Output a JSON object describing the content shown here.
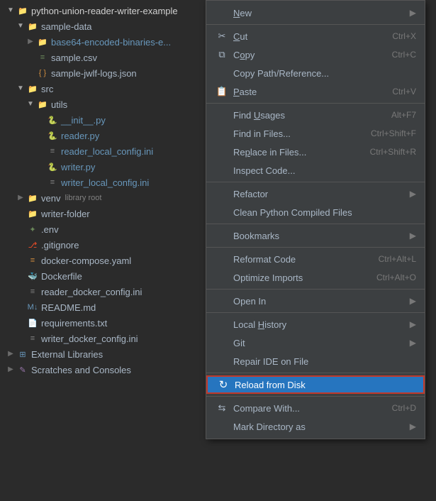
{
  "app": {
    "title": "python-union-reader-writer-example"
  },
  "filetree": {
    "items": [
      {
        "id": "root",
        "label": "python-union-reader-writer-exa...",
        "type": "folder-open",
        "indent": 1,
        "arrow": "▼"
      },
      {
        "id": "sample-data",
        "label": "sample-data",
        "type": "folder-open",
        "indent": 2,
        "arrow": "▼"
      },
      {
        "id": "base64",
        "label": "base64-encoded-binaries-e...",
        "type": "folder",
        "indent": 3,
        "arrow": "▶"
      },
      {
        "id": "sample-csv",
        "label": "sample.csv",
        "type": "csv",
        "indent": 3,
        "arrow": ""
      },
      {
        "id": "sample-json",
        "label": "sample-jwlf-logs.json",
        "type": "json",
        "indent": 3,
        "arrow": ""
      },
      {
        "id": "src",
        "label": "src",
        "type": "folder-open",
        "indent": 2,
        "arrow": "▼"
      },
      {
        "id": "utils",
        "label": "utils",
        "type": "folder-open",
        "indent": 3,
        "arrow": "▼"
      },
      {
        "id": "init",
        "label": "__init__.py",
        "type": "python",
        "indent": 4,
        "arrow": ""
      },
      {
        "id": "reader",
        "label": "reader.py",
        "type": "python",
        "indent": 4,
        "arrow": ""
      },
      {
        "id": "reader-config",
        "label": "reader_local_config.ini",
        "type": "ini",
        "indent": 4,
        "arrow": ""
      },
      {
        "id": "writer",
        "label": "writer.py",
        "type": "python",
        "indent": 4,
        "arrow": ""
      },
      {
        "id": "writer-config",
        "label": "writer_local_config.ini",
        "type": "ini",
        "indent": 4,
        "arrow": ""
      },
      {
        "id": "venv",
        "label": "venv",
        "type": "folder",
        "indent": 2,
        "arrow": "▶",
        "badge": "library root"
      },
      {
        "id": "writer-folder",
        "label": "writer-folder",
        "type": "folder",
        "indent": 2,
        "arrow": ""
      },
      {
        "id": "env",
        "label": ".env",
        "type": "env",
        "indent": 2,
        "arrow": ""
      },
      {
        "id": "gitignore",
        "label": ".gitignore",
        "type": "git",
        "indent": 2,
        "arrow": ""
      },
      {
        "id": "docker-compose",
        "label": "docker-compose.yaml",
        "type": "yaml",
        "indent": 2,
        "arrow": ""
      },
      {
        "id": "dockerfile",
        "label": "Dockerfile",
        "type": "docker",
        "indent": 2,
        "arrow": ""
      },
      {
        "id": "reader-docker",
        "label": "reader_docker_config.ini",
        "type": "ini",
        "indent": 2,
        "arrow": ""
      },
      {
        "id": "readme",
        "label": "README.md",
        "type": "md",
        "indent": 2,
        "arrow": ""
      },
      {
        "id": "requirements",
        "label": "requirements.txt",
        "type": "txt",
        "indent": 2,
        "arrow": ""
      },
      {
        "id": "writer-docker",
        "label": "writer_docker_config.ini",
        "type": "ini",
        "indent": 2,
        "arrow": ""
      },
      {
        "id": "ext-libs",
        "label": "External Libraries",
        "type": "library",
        "indent": 1,
        "arrow": "▶"
      },
      {
        "id": "scratches",
        "label": "Scratches and Consoles",
        "type": "scratch",
        "indent": 1,
        "arrow": "▶"
      }
    ]
  },
  "contextmenu": {
    "items": [
      {
        "id": "new",
        "label": "New",
        "icon": "",
        "shortcut": "",
        "arrow": "▶",
        "separator_after": false,
        "type": "submenu"
      },
      {
        "id": "sep1",
        "type": "separator"
      },
      {
        "id": "cut",
        "label": "Cut",
        "icon": "✂",
        "shortcut": "Ctrl+X",
        "arrow": "",
        "type": "action",
        "underline_char": "C"
      },
      {
        "id": "copy",
        "label": "Copy",
        "icon": "⧉",
        "shortcut": "Ctrl+C",
        "arrow": "",
        "type": "action",
        "underline_char": "o"
      },
      {
        "id": "copy-path",
        "label": "Copy Path/Reference...",
        "icon": "",
        "shortcut": "",
        "arrow": "",
        "type": "action"
      },
      {
        "id": "paste",
        "label": "Paste",
        "icon": "📋",
        "shortcut": "Ctrl+V",
        "arrow": "",
        "type": "action",
        "underline_char": "P"
      },
      {
        "id": "sep2",
        "type": "separator"
      },
      {
        "id": "find-usages",
        "label": "Find Usages",
        "icon": "",
        "shortcut": "Alt+F7",
        "arrow": "",
        "type": "action",
        "underline_char": "U"
      },
      {
        "id": "find-in-files",
        "label": "Find in Files...",
        "icon": "",
        "shortcut": "Ctrl+Shift+F",
        "arrow": "",
        "type": "action"
      },
      {
        "id": "replace-in-files",
        "label": "Replace in Files...",
        "icon": "",
        "shortcut": "Ctrl+Shift+R",
        "arrow": "",
        "type": "action"
      },
      {
        "id": "inspect-code",
        "label": "Inspect Code...",
        "icon": "",
        "shortcut": "",
        "arrow": "",
        "type": "action"
      },
      {
        "id": "sep3",
        "type": "separator"
      },
      {
        "id": "refactor",
        "label": "Refactor",
        "icon": "",
        "shortcut": "",
        "arrow": "▶",
        "type": "submenu"
      },
      {
        "id": "clean-python",
        "label": "Clean Python Compiled Files",
        "icon": "",
        "shortcut": "",
        "arrow": "",
        "type": "action"
      },
      {
        "id": "sep4",
        "type": "separator"
      },
      {
        "id": "bookmarks",
        "label": "Bookmarks",
        "icon": "",
        "shortcut": "",
        "arrow": "▶",
        "type": "submenu"
      },
      {
        "id": "sep5",
        "type": "separator"
      },
      {
        "id": "reformat",
        "label": "Reformat Code",
        "icon": "",
        "shortcut": "Ctrl+Alt+L",
        "arrow": "",
        "type": "action"
      },
      {
        "id": "optimize-imports",
        "label": "Optimize Imports",
        "icon": "",
        "shortcut": "Ctrl+Alt+O",
        "arrow": "",
        "type": "action"
      },
      {
        "id": "sep6",
        "type": "separator"
      },
      {
        "id": "open-in",
        "label": "Open In",
        "icon": "",
        "shortcut": "",
        "arrow": "▶",
        "type": "submenu"
      },
      {
        "id": "sep7",
        "type": "separator"
      },
      {
        "id": "local-history",
        "label": "Local History",
        "icon": "",
        "shortcut": "",
        "arrow": "▶",
        "type": "submenu"
      },
      {
        "id": "git",
        "label": "Git",
        "icon": "",
        "shortcut": "",
        "arrow": "▶",
        "type": "submenu"
      },
      {
        "id": "repair-ide",
        "label": "Repair IDE on File",
        "icon": "",
        "shortcut": "",
        "arrow": "",
        "type": "action"
      },
      {
        "id": "sep8",
        "type": "separator"
      },
      {
        "id": "reload-disk",
        "label": "Reload from Disk",
        "icon": "↻",
        "shortcut": "",
        "arrow": "",
        "type": "action",
        "highlighted": true
      },
      {
        "id": "sep9",
        "type": "separator"
      },
      {
        "id": "compare-with",
        "label": "Compare With...",
        "icon": "⇆",
        "shortcut": "Ctrl+D",
        "arrow": "",
        "type": "action"
      },
      {
        "id": "mark-dir",
        "label": "Mark Directory as",
        "icon": "",
        "shortcut": "",
        "arrow": "▶",
        "type": "submenu"
      }
    ]
  }
}
